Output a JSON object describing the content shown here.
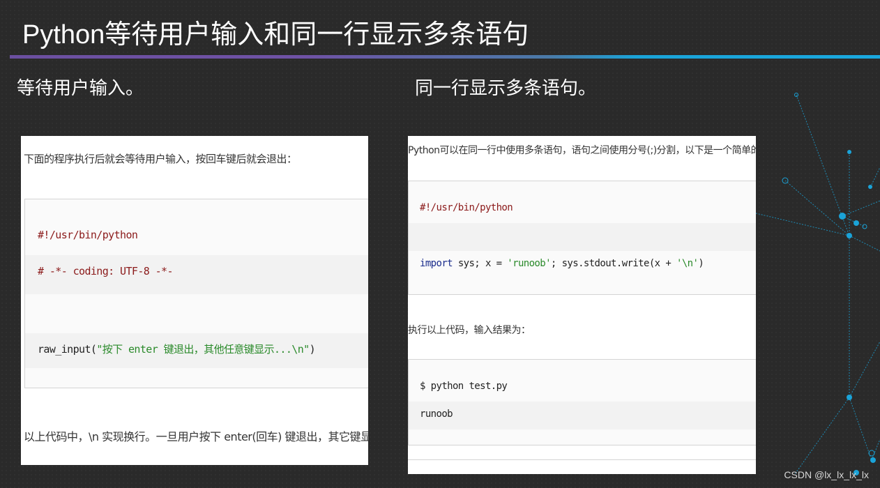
{
  "slide": {
    "title": "Python等待用户输入和同一行显示多条语句",
    "watermark": "CSDN @lx_lx_lx_lx"
  },
  "left": {
    "heading": "等待用户输入。",
    "intro": "下面的程序执行后就会等待用户输入，按回车键后就会退出：",
    "code": {
      "shebang": "#!/usr/bin/python",
      "coding": "# -*- coding: UTF-8 -*-",
      "call_name": "raw_input",
      "call_open": "(",
      "call_string": "\"按下 enter 键退出，其他任意键显示...\\n\"",
      "call_close": ")"
    },
    "note": "以上代码中，\\n 实现换行。一旦用户按下 enter(回车) 键退出，其它键显示。"
  },
  "right": {
    "heading": "同一行显示多条语句。",
    "intro": "Python可以在同一行中使用多条语句，语句之间使用分号(;)分割，以下是一个简单的实例：",
    "code": {
      "shebang": "#!/usr/bin/python",
      "import_kw": "import",
      "import_rest": " sys; x = ",
      "string_value": "'runoob'",
      "write_call": "; sys.stdout.write(x + ",
      "newline_string": "'\\n'",
      "close": ")"
    },
    "result_intro": "执行以上代码，输入结果为：",
    "output": {
      "command": "$ python test.py",
      "result": "runoob"
    }
  },
  "colors": {
    "background": "#2a2a2a",
    "title_rule_start": "#6b4fa0",
    "title_rule_end": "#1aa8de",
    "network_accent": "#1aa3d8"
  }
}
